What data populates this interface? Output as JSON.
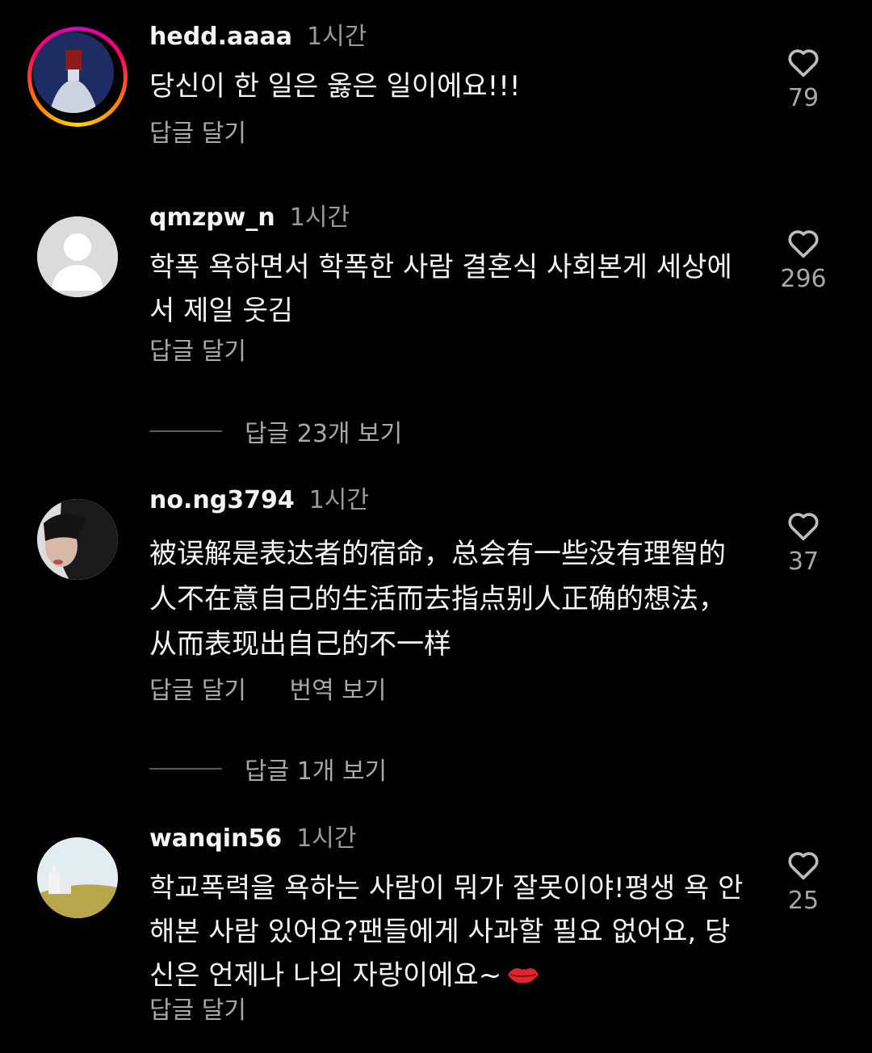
{
  "comments": [
    {
      "username": "hedd.aaaa",
      "time": "1시간",
      "text": "당신이 한 일은 옳은 일이에요!!!",
      "reply_label": "답글 달기",
      "like_count": "79"
    },
    {
      "username": "qmzpw_n",
      "time": "1시간",
      "text": "학폭 욕하면서 학폭한 사람 결혼식 사회본게 세상에서 제일 웃김",
      "reply_label": "답글 달기",
      "like_count": "296",
      "view_replies": "답글 23개 보기"
    },
    {
      "username": "no.ng3794",
      "time": "1시간",
      "text": "被误解是表达者的宿命，总会有一些没有理智的人不在意自己的生活而去指点别人正确的想法，从而表现出自己的不一样",
      "reply_label": "답글 달기",
      "translate_label": "번역 보기",
      "like_count": "37",
      "view_replies": "답글 1개 보기"
    },
    {
      "username": "wanqin56",
      "time": "1시간",
      "text": "학교폭력을 욕하는 사람이 뭐가 잘못이야!평생 욕 안 해본 사람 있어요?팬들에게 사과할 필요 없어요, 당신은 언제나 나의 자랑이에요~",
      "reply_label": "답글 달기",
      "like_count": "25"
    }
  ],
  "icons": {
    "heart": "heart-outline-icon",
    "kiss": "kiss-mark-emoji"
  },
  "colors": {
    "background": "#000000",
    "primary_text": "#f5f5f5",
    "secondary_text": "#a8a8a8"
  }
}
